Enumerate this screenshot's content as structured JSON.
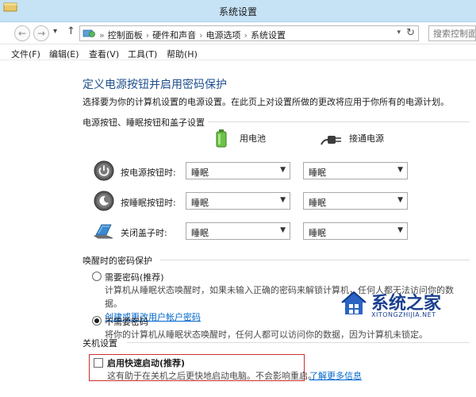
{
  "window": {
    "title": "系统设置"
  },
  "address": {
    "crumbs": [
      "控制面板",
      "硬件和声音",
      "电源选项",
      "系统设置"
    ],
    "search_placeholder": "搜索控制面板"
  },
  "menu": [
    "文件(F)",
    "编辑(E)",
    "查看(V)",
    "工具(T)",
    "帮助(H)"
  ],
  "page": {
    "heading": "定义电源按钮并启用密码保护",
    "description": "选择要为你的计算机设置的电源设置。在此页上对设置所做的更改将应用于你所有的电源计划。"
  },
  "power_section": {
    "title": "电源按钮、睡眠按钮和盖子设置",
    "col_battery": "用电池",
    "col_plugged": "接通电源",
    "rows": [
      {
        "label": "按电源按钮时:",
        "icon": "power-button-icon",
        "battery": "睡眠",
        "plugged": "睡眠"
      },
      {
        "label": "按睡眠按钮时:",
        "icon": "sleep-button-icon",
        "battery": "睡眠",
        "plugged": "睡眠"
      },
      {
        "label": "关闭盖子时:",
        "icon": "laptop-lid-icon",
        "battery": "睡眠",
        "plugged": "睡眠"
      }
    ]
  },
  "wake_section": {
    "title": "唤醒时的密码保护",
    "require": {
      "label": "需要密码(推荐)",
      "desc": "计算机从睡眠状态唤醒时，如果未输入正确的密码来解锁计算机，任何人都无法访问你的数据。",
      "link": "创建或更改用户帐户密码",
      "selected": false
    },
    "no_require": {
      "label": "不需要密码",
      "desc": "将你的计算机从睡眠状态唤醒时，任何人都可以访问你的数据，因为计算机未锁定。",
      "selected": true
    }
  },
  "shutdown_section": {
    "title": "关机设置",
    "fast_startup": {
      "label": "启用快速启动(推荐)",
      "desc": "这有助于在关机之后更快地启动电脑。不会影响重启。",
      "link": "了解更多信息",
      "checked": false
    }
  },
  "watermark": {
    "title": "系统之家",
    "url": "XITONGZHIJIA.NET"
  },
  "colors": {
    "titlebar": "#c5e3f5",
    "heading": "#1e4e8c",
    "link": "#0066cc",
    "highlight_border": "#c9302c",
    "watermark": "#1a3f8f"
  }
}
